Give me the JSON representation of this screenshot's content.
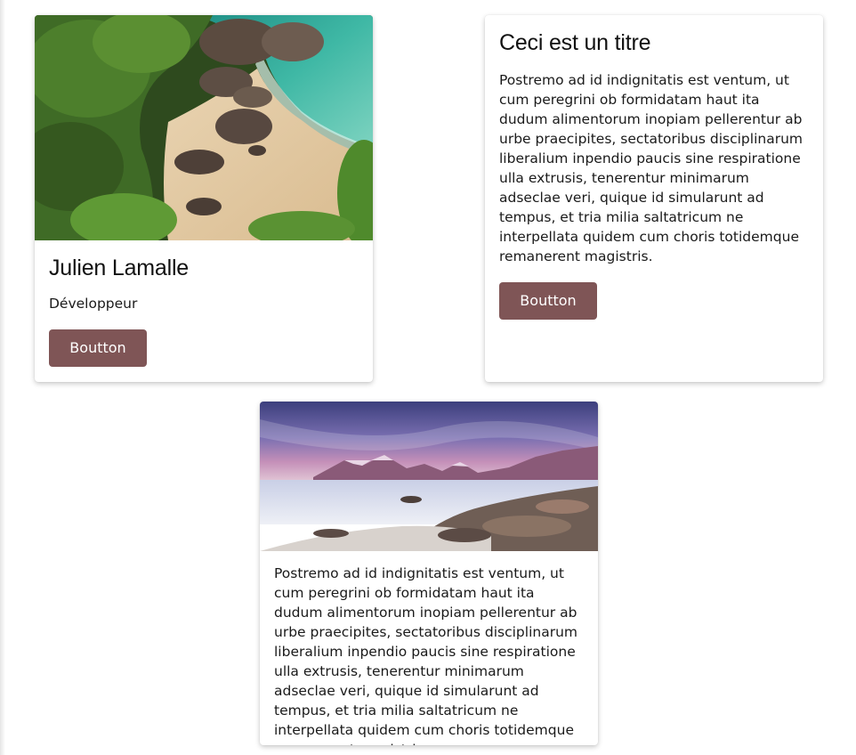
{
  "cards": [
    {
      "image": {
        "icon": "beach-cove-photo"
      },
      "title": "Julien Lamalle",
      "subtitle": "Développeur",
      "button_label": "Boutton"
    },
    {
      "title": "Ceci est un titre",
      "text": "Postremo ad id indignitatis est ventum, ut cum peregrini ob formidatam haut ita dudum alimentorum inopiam pellerentur ab urbe praecipites, sectatoribus disciplinarum liberalium inpendio paucis sine respiratione ulla extrusis, tenerentur minimarum adseclae veri, quique id simularunt ad tempus, et tria milia saltatricum ne interpellata quidem cum choris totidemque remanerent magistris.",
      "button_label": "Boutton"
    },
    {
      "image": {
        "icon": "lake-mountains-photo"
      },
      "text": "Postremo ad id indignitatis est ventum, ut cum peregrini ob formidatam haut ita dudum alimentorum inopiam pellerentur ab urbe praecipites, sectatoribus disciplinarum liberalium inpendio paucis sine respiratione ulla extrusis, tenerentur minimarum adseclae veri, quique id simularunt ad tempus, et tria milia saltatricum ne interpellata quidem cum choris totidemque remanerent magistris."
    }
  ],
  "colors": {
    "button": "#7f5556",
    "button_text": "#ffffff",
    "card": "#ffffff",
    "page": "#ffffff"
  }
}
